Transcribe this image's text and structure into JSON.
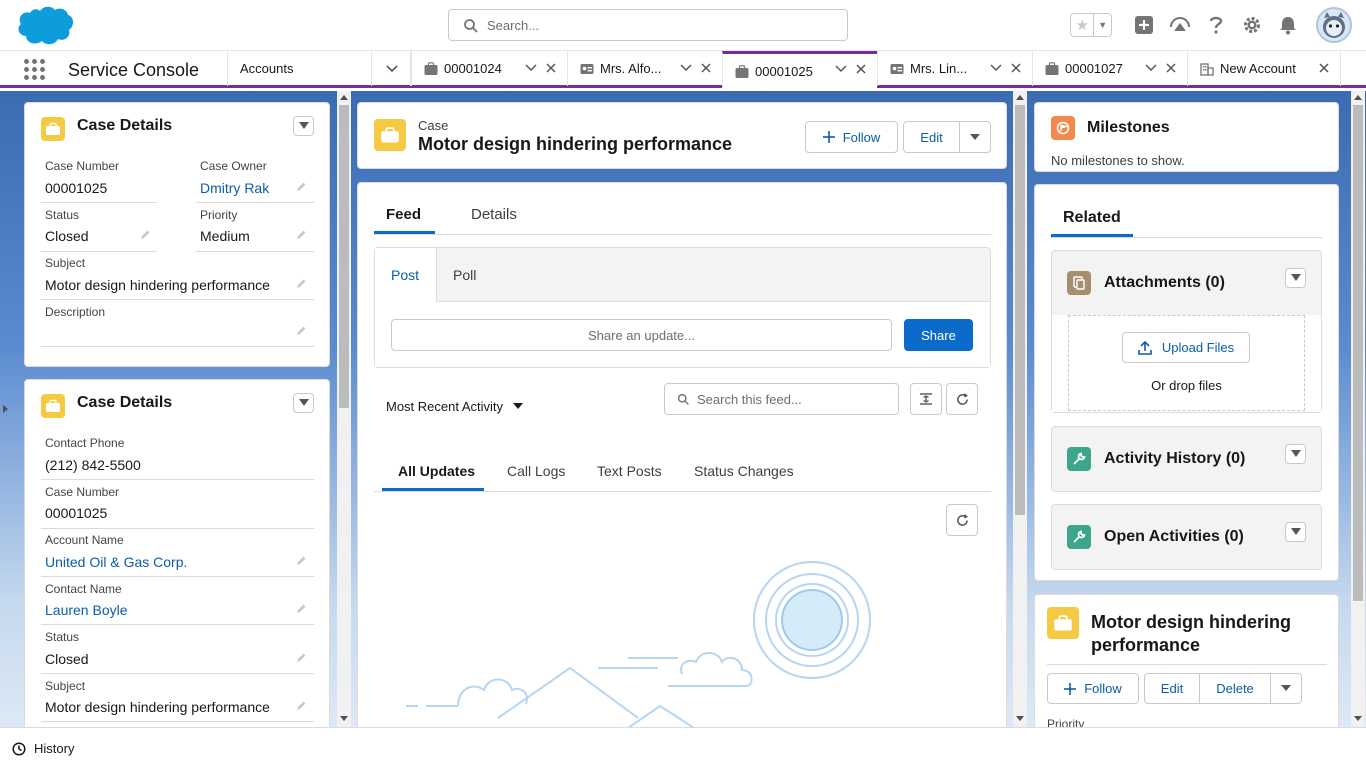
{
  "header": {
    "search_placeholder": "Search..."
  },
  "tabbar": {
    "app_name": "Service Console",
    "tabs": [
      {
        "label": "Accounts"
      },
      {
        "label": "00001024"
      },
      {
        "label": "Mrs. Alfo..."
      },
      {
        "label": "00001025"
      },
      {
        "label": "Mrs. Lin..."
      },
      {
        "label": "00001027"
      },
      {
        "label": "New Account"
      }
    ]
  },
  "left": {
    "card1": {
      "title": "Case Details",
      "case_number_label": "Case Number",
      "case_number": "00001025",
      "case_owner_label": "Case Owner",
      "case_owner": "Dmitry Rak",
      "status_label": "Status",
      "status": "Closed",
      "priority_label": "Priority",
      "priority": "Medium",
      "subject_label": "Subject",
      "subject": "Motor design hindering performance",
      "description_label": "Description"
    },
    "card2": {
      "title": "Case Details",
      "contact_phone_label": "Contact Phone",
      "contact_phone": "(212) 842-5500",
      "case_number_label": "Case Number",
      "case_number": "00001025",
      "account_name_label": "Account Name",
      "account_name": "United Oil & Gas Corp.",
      "contact_name_label": "Contact Name",
      "contact_name": "Lauren Boyle",
      "status_label": "Status",
      "status": "Closed",
      "subject_label": "Subject",
      "subject": "Motor design hindering performance"
    }
  },
  "center": {
    "record_type": "Case",
    "record_title": "Motor design hindering performance",
    "follow_label": "Follow",
    "edit_label": "Edit",
    "tabs": {
      "feed": "Feed",
      "details": "Details"
    },
    "publisher": {
      "post": "Post",
      "poll": "Poll",
      "share_placeholder": "Share an update...",
      "share_button": "Share"
    },
    "sort_label": "Most Recent Activity",
    "search_feed_placeholder": "Search this feed...",
    "filters": [
      "All Updates",
      "Call Logs",
      "Text Posts",
      "Status Changes"
    ]
  },
  "right": {
    "milestones_title": "Milestones",
    "milestones_empty": "No milestones to show.",
    "related_tab": "Related",
    "attachments_title": "Attachments (0)",
    "upload_files": "Upload Files",
    "or_drop_files": "Or drop files",
    "activity_history_title": "Activity History (0)",
    "open_activities_title": "Open Activities (0)",
    "highlights_title": "Motor design hindering performance",
    "follow_label": "Follow",
    "edit_label": "Edit",
    "delete_label": "Delete",
    "priority_label": "Priority"
  },
  "footer": {
    "history_label": "History"
  },
  "colors": {
    "brand_blue": "#0b6bcb",
    "active_tab_purple": "#7a2a9a",
    "case_icon": "#f5c942",
    "link": "#0b5cab"
  }
}
